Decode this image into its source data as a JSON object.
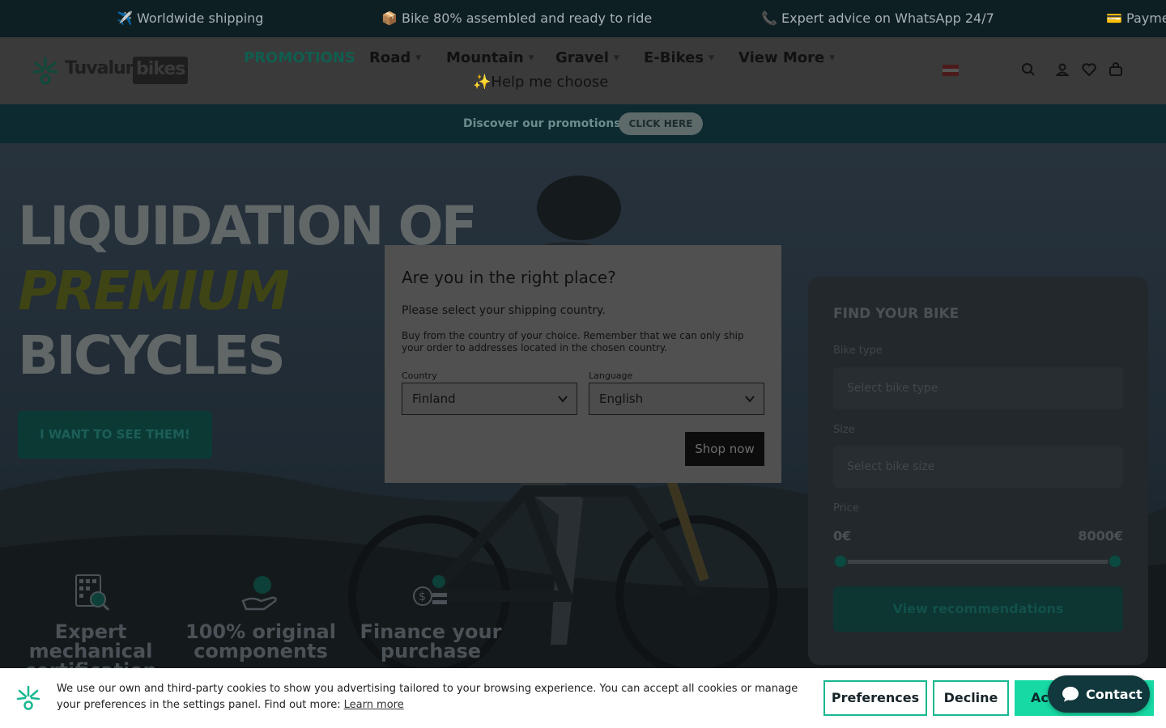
{
  "ticker": {
    "items": [
      "✈️ Worldwide shipping",
      "📦 Bike 80% assembled and ready to ride",
      "📞 Expert advice on WhatsApp 24/7",
      "💳 Payme"
    ]
  },
  "brand": {
    "name": "Tuvalum",
    "suffix": "bikes"
  },
  "nav": {
    "items": [
      {
        "label": "PROMOTIONS"
      },
      {
        "label": "Road"
      },
      {
        "label": "Mountain"
      },
      {
        "label": "Gravel"
      },
      {
        "label": "E-Bikes"
      },
      {
        "label": "View More"
      }
    ],
    "help": "✨Help me choose"
  },
  "promo": {
    "text": "Discover our promotions!",
    "button": "CLICK HERE"
  },
  "hero": {
    "line1": "LIQUIDATION OF",
    "line2": "PREMIUM",
    "line3": "BICYCLES",
    "cta": "I WANT TO SEE THEM!"
  },
  "features": [
    {
      "label": "Expert mechanical certification",
      "icon": "checklist-icon"
    },
    {
      "label": "100% original components",
      "icon": "hand-globe-icon"
    },
    {
      "label": "Finance your purchase",
      "icon": "finance-icon"
    }
  ],
  "finder": {
    "title": "FIND YOUR BIKE",
    "bike_type_label": "Bike type",
    "bike_type_placeholder": "Select bike type",
    "size_label": "Size",
    "size_placeholder": "Select bike size",
    "price_label": "Price",
    "price_min": "0€",
    "price_max": "8000€",
    "button": "View recommendations"
  },
  "modal": {
    "title": "Are you in the right place?",
    "subtitle": "Please select your shipping country.",
    "note": "Buy from the country of your choice. Remember that we can only ship your order to addresses located in the chosen country.",
    "country_label": "Country",
    "country_value": "Finland",
    "language_label": "Language",
    "language_value": "English",
    "button": "Shop now"
  },
  "cookie": {
    "text": "We use our own and third-party cookies to show you advertising tailored to your browsing experience. You can accept all cookies or manage your preferences in the settings panel. Find out more:",
    "link": "Learn more",
    "preferences": "Preferences",
    "decline": "Decline",
    "accept": "Acc"
  },
  "contact": {
    "label": "Contact"
  },
  "colors": {
    "accent": "#17d9a3",
    "overlay": "rgba(0,0,0,0.68)",
    "ticker_bg": "#0e1f24"
  }
}
